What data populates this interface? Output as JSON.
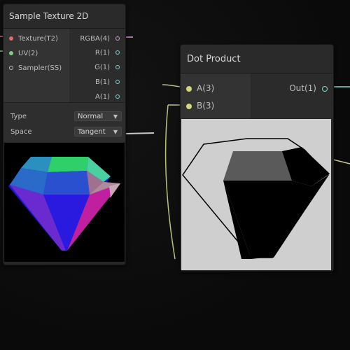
{
  "sample_texture_node": {
    "title": "Sample Texture 2D",
    "inputs": [
      {
        "label": "Texture(T2)",
        "color": "#e06a6a"
      },
      {
        "label": "UV(2)",
        "color": "#7fcf7f"
      },
      {
        "label": "Sampler(SS)",
        "color": "#bfbfbf"
      }
    ],
    "outputs": [
      {
        "label": "RGBA(4)",
        "color": "#d99ad9"
      },
      {
        "label": "R(1)",
        "color": "#7fd3d3"
      },
      {
        "label": "G(1)",
        "color": "#7fd3d3"
      },
      {
        "label": "B(1)",
        "color": "#7fd3d3"
      },
      {
        "label": "A(1)",
        "color": "#7fd3d3"
      }
    ],
    "type_label": "Type",
    "type_value": "Normal",
    "space_label": "Space",
    "space_value": "Tangent"
  },
  "dot_product_node": {
    "title": "Dot Product",
    "inputs": [
      {
        "label": "A(3)",
        "color": "#d6d67a"
      },
      {
        "label": "B(3)",
        "color": "#d6d67a"
      }
    ],
    "output": {
      "label": "Out(1)",
      "color": "#7fd3d3"
    }
  },
  "colors": {
    "vector3_wire": "#c9c98a",
    "float_wire": "#8fd6d6"
  }
}
